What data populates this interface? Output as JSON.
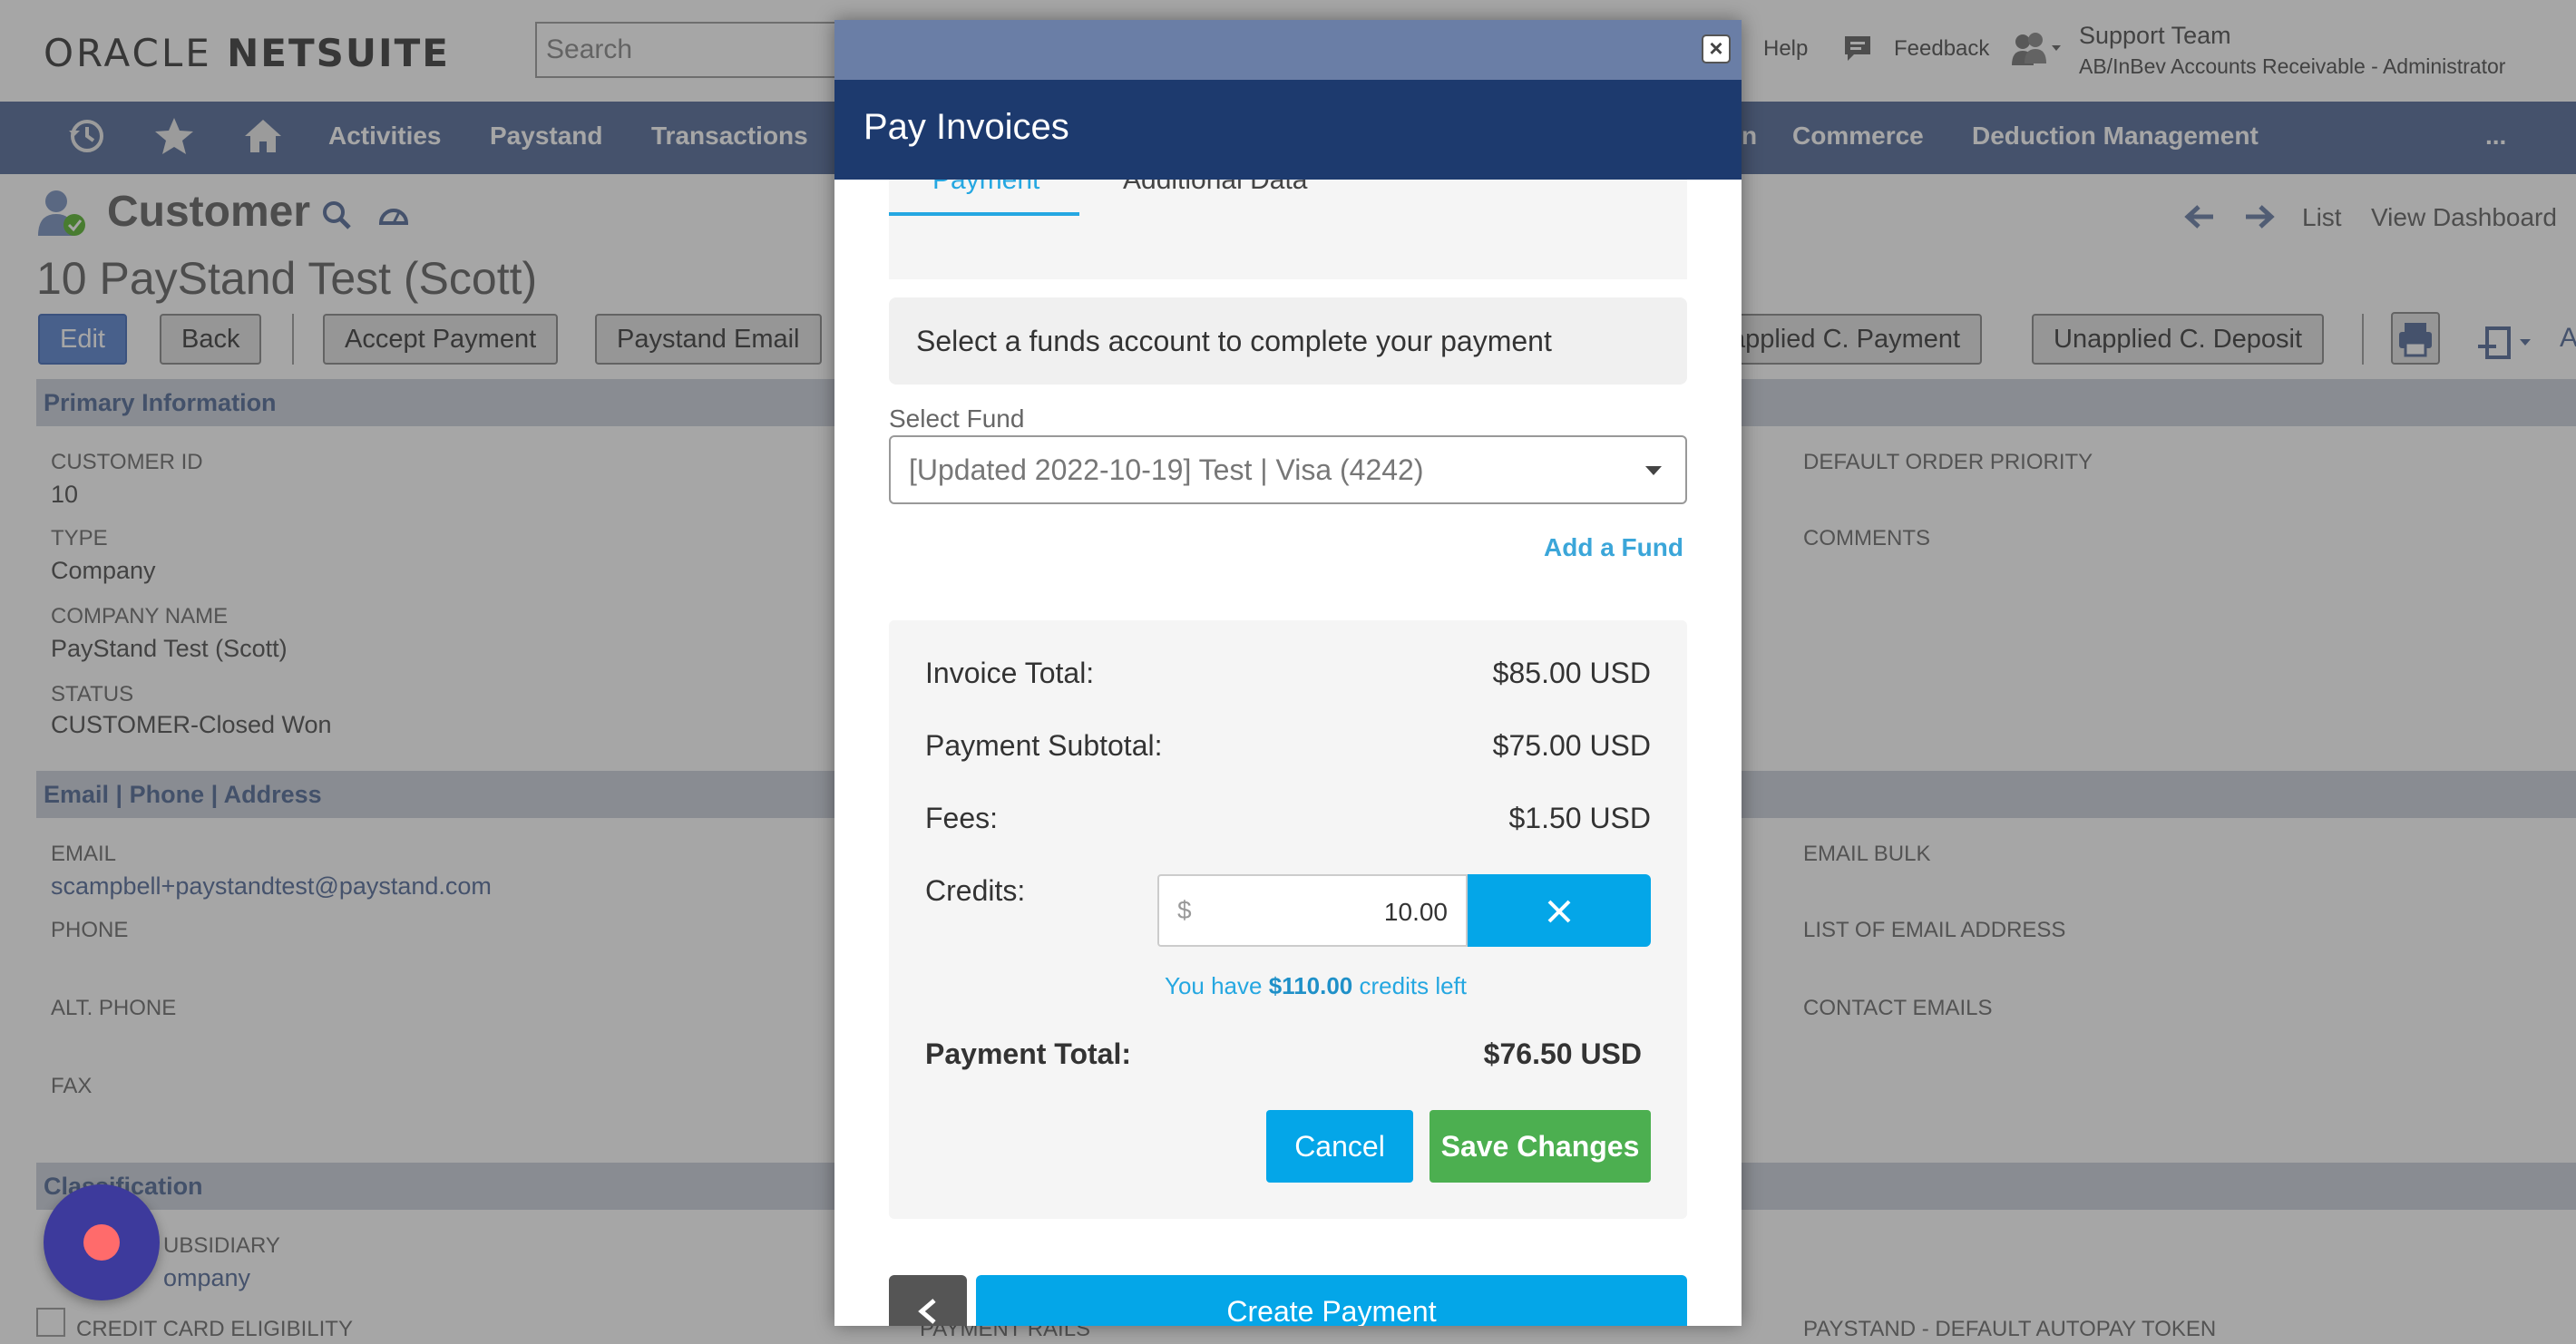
{
  "app": {
    "logo_prefix": "ORACLE",
    "logo_suffix": "NETSUITE",
    "search_placeholder": "Search",
    "help": "Help",
    "feedback": "Feedback",
    "user_name": "Support Team",
    "user_role": "AB/InBev Accounts Receivable - Administrator"
  },
  "nav": {
    "items": [
      "Activities",
      "Paystand",
      "Transactions",
      "n",
      "Commerce",
      "Deduction Management"
    ],
    "more": "..."
  },
  "record": {
    "type_title": "Customer",
    "name": "10 PayStand Test (Scott)",
    "header_links": [
      "List",
      "View Dashboard"
    ],
    "partial_right": "A"
  },
  "actions": {
    "edit": "Edit",
    "back": "Back",
    "accept_payment": "Accept Payment",
    "paystand_email": "Paystand Email",
    "unapplied_payment": "applied C. Payment",
    "unapplied_deposit": "Unapplied C. Deposit"
  },
  "sections": {
    "primary": "Primary Information",
    "email_phone": "Email | Phone | Address",
    "classification": "Classification"
  },
  "fields": {
    "customer_id_label": "CUSTOMER ID",
    "customer_id": "10",
    "type_label": "TYPE",
    "type": "Company",
    "company_name_label": "COMPANY NAME",
    "company_name": "PayStand Test (Scott)",
    "status_label": "STATUS",
    "status": "CUSTOMER-Closed Won",
    "default_order_priority_label": "DEFAULT ORDER PRIORITY",
    "comments_label": "COMMENTS",
    "email_label": "EMAIL",
    "email": "scampbell+paystandtest@paystand.com",
    "phone_label": "PHONE",
    "alt_phone_label": "ALT. PHONE",
    "fax_label": "FAX",
    "email_bulk_label": "EMAIL BULK",
    "list_email_label": "LIST OF EMAIL ADDRESS",
    "contact_emails_label": "CONTACT EMAILS",
    "subsidiary_label": "UBSIDIARY",
    "subsidiary": "ompany",
    "cc_eligibility_label": "CREDIT CARD ELIGIBILITY",
    "payment_rails_label": "PAYMENT RAILS",
    "default_autopay_label": "PAYSTAND - DEFAULT AUTOPAY TOKEN"
  },
  "modal": {
    "title": "Pay Invoices",
    "close": "×",
    "tabs": [
      "Payment",
      "Additional Data"
    ],
    "instruction": "Select a funds account to complete your payment",
    "select_fund_label": "Select Fund",
    "select_fund_value": "[Updated 2022-10-19] Test | Visa (4242)",
    "add_fund": "Add a Fund",
    "invoice_total_label": "Invoice Total:",
    "invoice_total": "$85.00 USD",
    "payment_subtotal_label": "Payment Subtotal:",
    "payment_subtotal": "$75.00 USD",
    "fees_label": "Fees:",
    "fees": "$1.50 USD",
    "credits_label": "Credits:",
    "credits_currency": "$",
    "credits_value": "10.00",
    "credits_left_prefix": "You have",
    "credits_left_amount": "$110.00",
    "credits_left_suffix": "credits left",
    "payment_total_label": "Payment Total:",
    "payment_total": "$76.50 USD",
    "cancel": "Cancel",
    "save": "Save Changes",
    "create_payment": "Create Payment"
  },
  "colors": {
    "nav_bg": "#6b7fa6",
    "modal_header": "#1d3a6e",
    "primary_blue": "#04a6e8",
    "save_green": "#4caf50",
    "chat_bubble": "#3d3a9c"
  }
}
